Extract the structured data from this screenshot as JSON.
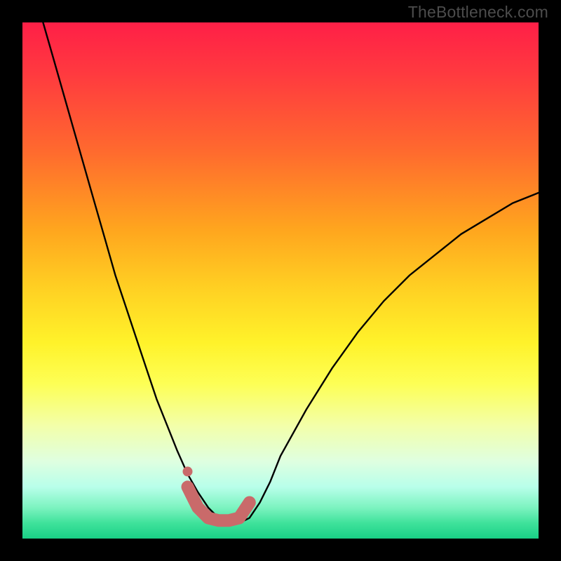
{
  "attribution": "TheBottleneck.com",
  "chart_data": {
    "type": "line",
    "title": "",
    "xlabel": "",
    "ylabel": "",
    "xlim": [
      0,
      100
    ],
    "ylim": [
      0,
      100
    ],
    "grid": false,
    "legend": false,
    "series": [
      {
        "name": "bottleneck-curve",
        "color": "#000000",
        "x": [
          4,
          6,
          8,
          10,
          12,
          14,
          16,
          18,
          20,
          22,
          24,
          26,
          28,
          30,
          32,
          34,
          36,
          38,
          40,
          42,
          44,
          46,
          48,
          50,
          55,
          60,
          65,
          70,
          75,
          80,
          85,
          90,
          95,
          100
        ],
        "y": [
          100,
          93,
          86,
          79,
          72,
          65,
          58,
          51,
          45,
          39,
          33,
          27,
          22,
          17,
          12.5,
          9,
          6,
          4,
          3,
          3,
          4,
          7,
          11,
          16,
          25,
          33,
          40,
          46,
          51,
          55,
          59,
          62,
          65,
          67
        ]
      },
      {
        "name": "highlight-band",
        "color": "#c96a6a",
        "x": [
          32,
          34,
          36,
          38,
          40,
          42,
          44
        ],
        "y": [
          10,
          6,
          4,
          3.5,
          3.5,
          4,
          7
        ]
      }
    ],
    "background_gradient": {
      "top": "#ff1f47",
      "mid": "#fff22a",
      "bottom": "#19d086"
    }
  }
}
